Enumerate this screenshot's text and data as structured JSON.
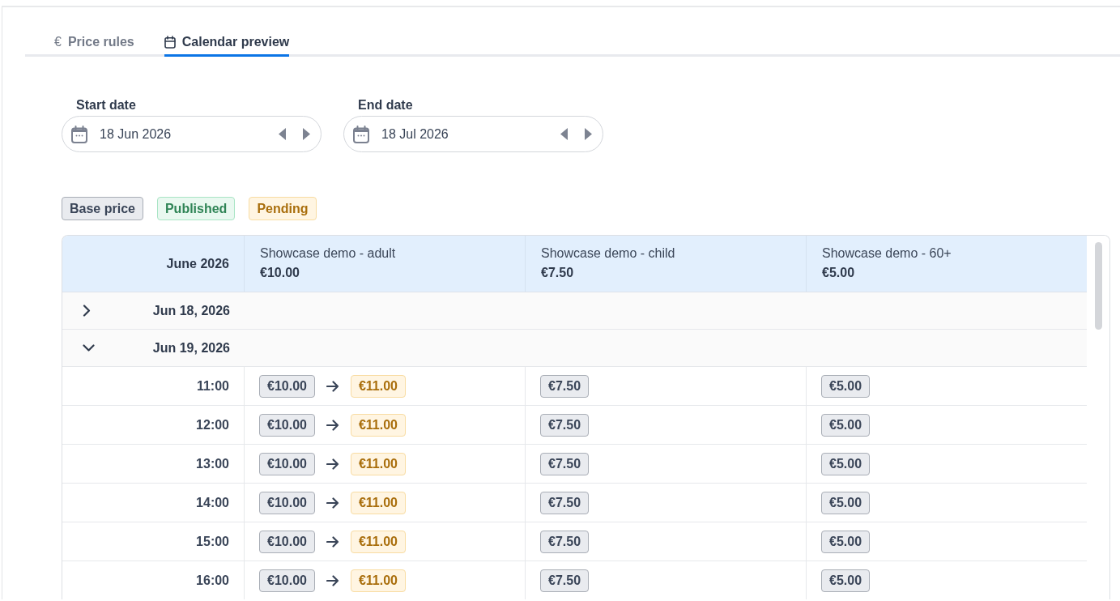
{
  "tabs": [
    {
      "glyph": "€",
      "label": "Price rules",
      "selected": false
    },
    {
      "label": "Calendar preview",
      "selected": true
    }
  ],
  "date_fields": [
    {
      "label": "Start date",
      "value": "18 Jun 2026"
    },
    {
      "label": "End date",
      "value": "18 Jul 2026"
    }
  ],
  "legend": [
    {
      "label": "Base price",
      "kind": "base"
    },
    {
      "label": "Published",
      "kind": "published"
    },
    {
      "label": "Pending",
      "kind": "pending"
    }
  ],
  "table": {
    "month": "June 2026",
    "columns": [
      {
        "name": "Showcase demo - adult",
        "price": "€10.00"
      },
      {
        "name": "Showcase demo - child",
        "price": "€7.50"
      },
      {
        "name": "Showcase demo - 60+",
        "price": "€5.00"
      }
    ],
    "groups": [
      {
        "date": "Jun 18, 2026",
        "expanded": false
      },
      {
        "date": "Jun 19, 2026",
        "expanded": true,
        "rows": [
          {
            "time": "11:00",
            "cells": [
              [
                {
                  "price": "€10.00",
                  "kind": "base"
                },
                {
                  "price": "€11.00",
                  "kind": "pending"
                }
              ],
              [
                {
                  "price": "€7.50",
                  "kind": "base"
                }
              ],
              [
                {
                  "price": "€5.00",
                  "kind": "base"
                }
              ]
            ]
          },
          {
            "time": "12:00",
            "cells": [
              [
                {
                  "price": "€10.00",
                  "kind": "base"
                },
                {
                  "price": "€11.00",
                  "kind": "pending"
                }
              ],
              [
                {
                  "price": "€7.50",
                  "kind": "base"
                }
              ],
              [
                {
                  "price": "€5.00",
                  "kind": "base"
                }
              ]
            ]
          },
          {
            "time": "13:00",
            "cells": [
              [
                {
                  "price": "€10.00",
                  "kind": "base"
                },
                {
                  "price": "€11.00",
                  "kind": "pending"
                }
              ],
              [
                {
                  "price": "€7.50",
                  "kind": "base"
                }
              ],
              [
                {
                  "price": "€5.00",
                  "kind": "base"
                }
              ]
            ]
          },
          {
            "time": "14:00",
            "cells": [
              [
                {
                  "price": "€10.00",
                  "kind": "base"
                },
                {
                  "price": "€11.00",
                  "kind": "pending"
                }
              ],
              [
                {
                  "price": "€7.50",
                  "kind": "base"
                }
              ],
              [
                {
                  "price": "€5.00",
                  "kind": "base"
                }
              ]
            ]
          },
          {
            "time": "15:00",
            "cells": [
              [
                {
                  "price": "€10.00",
                  "kind": "base"
                },
                {
                  "price": "€11.00",
                  "kind": "pending"
                }
              ],
              [
                {
                  "price": "€7.50",
                  "kind": "base"
                }
              ],
              [
                {
                  "price": "€5.00",
                  "kind": "base"
                }
              ]
            ]
          },
          {
            "time": "16:00",
            "cells": [
              [
                {
                  "price": "€10.00",
                  "kind": "base"
                },
                {
                  "price": "€11.00",
                  "kind": "pending"
                }
              ],
              [
                {
                  "price": "€7.50",
                  "kind": "base"
                }
              ],
              [
                {
                  "price": "€5.00",
                  "kind": "base"
                }
              ]
            ]
          }
        ]
      }
    ]
  }
}
